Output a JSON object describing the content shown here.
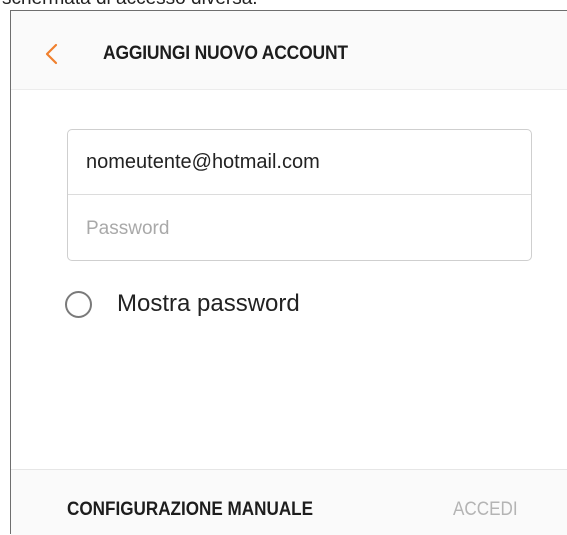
{
  "caption": {
    "text": "schermata di accesso diversa."
  },
  "header": {
    "back_icon": "chevron-left-icon",
    "title": "AGGIUNGI NUOVO ACCOUNT",
    "accent_color": "#f0802e"
  },
  "form": {
    "email": {
      "value": "nomeutente@hotmail.com"
    },
    "password": {
      "value": "",
      "placeholder": "Password"
    },
    "show_password": {
      "label": "Mostra password",
      "checked": false
    }
  },
  "footer": {
    "manual_config_label": "CONFIGURAZIONE MANUALE",
    "login_label": "ACCEDI",
    "login_enabled": false
  }
}
